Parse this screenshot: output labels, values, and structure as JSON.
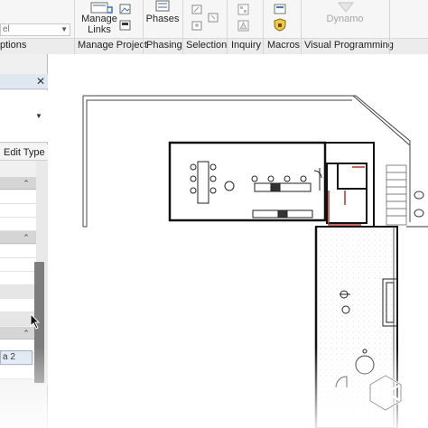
{
  "ribbon": {
    "left_label_fragment": "ptions",
    "dropdown_fragment": "el",
    "buttons": {
      "manage_links": "Manage\nLinks",
      "phases": "Phases",
      "dynamo": "Dynamo"
    },
    "groups": {
      "manage_project": "Manage Project",
      "phasing": "Phasing",
      "selection": "Selection",
      "inquiry": "Inquiry",
      "macros": "Macros",
      "visual_programming": "Visual Programming"
    }
  },
  "properties": {
    "close_glyph": "✕",
    "edit_type": "Edit Type",
    "selected_value": "a 2",
    "collapse_glyph": "⌃"
  },
  "colors": {
    "ribbon_bg": "#f6f6f6",
    "wall_dark": "#1a1a1a",
    "wall_red": "#b5322a",
    "selection_blue": "#dfe7f1"
  }
}
